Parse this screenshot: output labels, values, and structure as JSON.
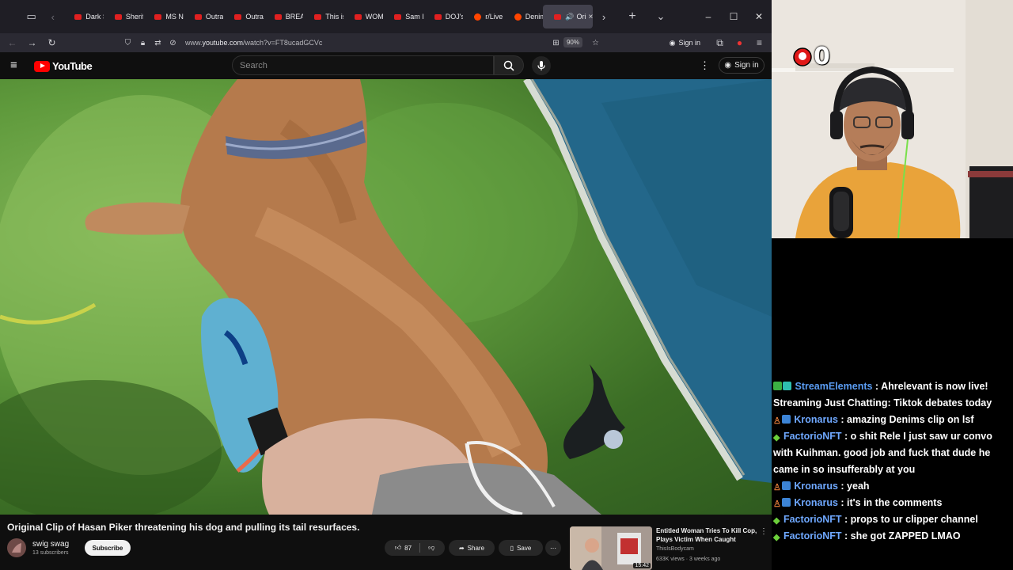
{
  "browser": {
    "tabs": [
      {
        "label": "Dark S",
        "favicon": "youtube"
      },
      {
        "label": "Sherif",
        "favicon": "youtube"
      },
      {
        "label": "MS N",
        "favicon": "youtube"
      },
      {
        "label": "Outra",
        "favicon": "youtube"
      },
      {
        "label": "Outra",
        "favicon": "youtube"
      },
      {
        "label": "BREAI",
        "favicon": "youtube"
      },
      {
        "label": "This is",
        "favicon": "youtube"
      },
      {
        "label": "WOM",
        "favicon": "youtube"
      },
      {
        "label": "Sam I",
        "favicon": "youtube"
      },
      {
        "label": "DOJ's",
        "favicon": "youtube"
      },
      {
        "label": "r/Live",
        "favicon": "reddit"
      },
      {
        "label": "Denim",
        "favicon": "reddit"
      }
    ],
    "active_tab": {
      "label": "Ori"
    },
    "url_prefix": "www.",
    "url_host": "youtube.com",
    "url_path": "/watch?v=FT8ucadGCVc",
    "zoom": "90%",
    "sign_in": "Sign in"
  },
  "youtube": {
    "logo_text": "YouTube",
    "search_placeholder": "Search",
    "sign_in": "Sign in",
    "video": {
      "title": "Original Clip of Hasan Piker threatening his dog and pulling its tail resurfaces.",
      "channel": "swig swag",
      "subscribers": "13 subscribers",
      "subscribe_label": "Subscribe",
      "likes": "87",
      "share_label": "Share",
      "save_label": "Save"
    },
    "recommended": {
      "title": "Entitled Woman Tries To Kill Cop, Plays Victim When Caught",
      "channel": "ThisIsBodycam",
      "meta": "633K views · 3 weeks ago",
      "duration": "15:42"
    }
  },
  "overlay": {
    "counter_value": "0"
  },
  "chat": {
    "messages": [
      {
        "badges": [
          "green",
          "teal"
        ],
        "user": "StreamElements",
        "text": "Ahrelevant is now live! Streaming Just Chatting: Tiktok debates today"
      },
      {
        "badges": [
          "orange",
          "blue"
        ],
        "user": "Kronarus",
        "text": "amazing Denims clip on lsf"
      },
      {
        "badges": [
          "diamond"
        ],
        "user": "FactorioNFT",
        "text": "o shit Rele I just saw ur convo with Kuihman. good job and fuck that dude he came in so insufferably at you"
      },
      {
        "badges": [
          "orange",
          "blue"
        ],
        "user": "Kronarus",
        "text": "yeah"
      },
      {
        "badges": [
          "orange",
          "blue"
        ],
        "user": "Kronarus",
        "text": "it's in the comments"
      },
      {
        "badges": [
          "diamond"
        ],
        "user": "FactorioNFT",
        "text": "props to ur clipper channel"
      },
      {
        "badges": [
          "diamond"
        ],
        "user": "FactorioNFT",
        "text": "she got ZAPPED LMAO"
      }
    ]
  }
}
